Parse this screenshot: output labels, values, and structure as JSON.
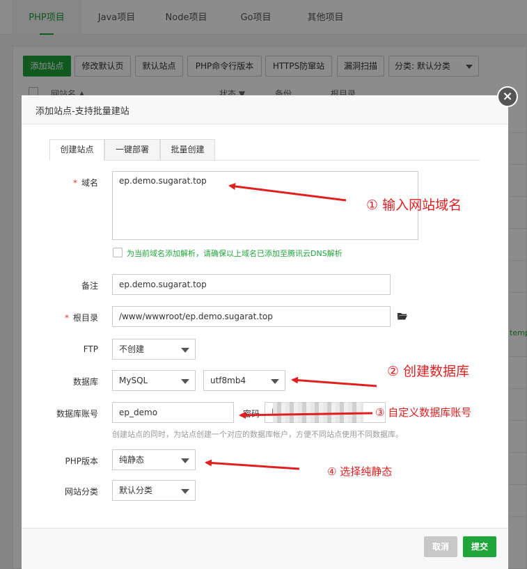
{
  "topnav": {
    "tabs": [
      "PHP项目",
      "Java项目",
      "Node项目",
      "Go项目",
      "其他项目"
    ],
    "active": 0
  },
  "toolbar": {
    "add_site": "添加站点",
    "edit_default_page": "修改默认页",
    "default_site": "默认站点",
    "php_cli_version": "PHP命令行版本",
    "https_firewall": "HTTPS防窜站",
    "vuln_scan": "漏洞扫描",
    "category_select": "分类: 默认分类"
  },
  "table_header": {
    "site_name": "网站名 ▲",
    "status": "状态 ▼",
    "backup": "备份",
    "root": "根目录"
  },
  "background_fragments": {
    "templ": "templa"
  },
  "modal": {
    "title": "添加站点-支持批量建站",
    "close_symbol": "×",
    "tabs": [
      "创建站点",
      "一键部署",
      "批量创建"
    ],
    "domain": {
      "label": "域名",
      "required": "*",
      "value": "ep.demo.sugarat.top"
    },
    "dns_checkbox": {
      "label": "为当前域名添加解析，请确保以上域名已添加至腾讯云DNS解析"
    },
    "remark": {
      "label": "备注",
      "value": "ep.demo.sugarat.top"
    },
    "root_dir": {
      "label": "根目录",
      "required": "*",
      "value": "/www/wwwroot/ep.demo.sugarat.top"
    },
    "ftp": {
      "label": "FTP",
      "value": "不创建"
    },
    "database": {
      "label": "数据库",
      "type": "MySQL",
      "charset": "utf8mb4"
    },
    "db_account": {
      "label": "数据库账号",
      "value": "ep_demo",
      "password_label": "密码",
      "password_prefix": "l",
      "hint": "创建站点的同时，为站点创建一个对应的数据库帐户，方便不同站点使用不同数据库。"
    },
    "php_version": {
      "label": "PHP版本",
      "value": "纯静态"
    },
    "site_category": {
      "label": "网站分类",
      "value": "默认分类"
    },
    "cancel": "取消",
    "submit": "提交"
  },
  "annotations": {
    "a1": "① 输入网站域名",
    "a2": "② 创建数据库",
    "a3": "③ 自定义数据库账号",
    "a4": "④ 选择纯静态"
  },
  "colors": {
    "brand_green": "#20a53a",
    "annotation_red": "#e02020"
  }
}
